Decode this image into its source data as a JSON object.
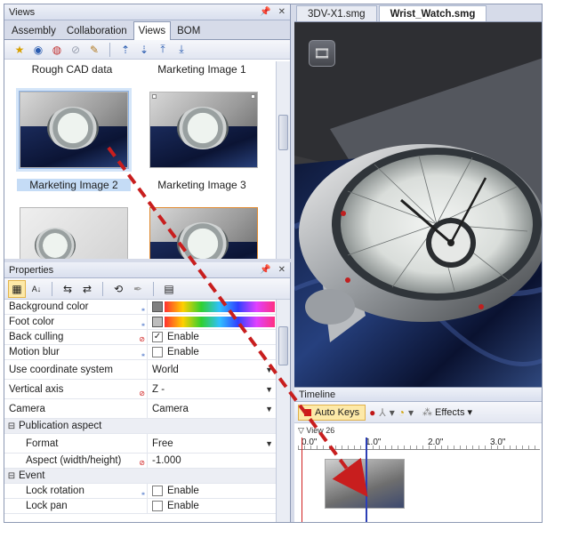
{
  "views_panel": {
    "title": "Views",
    "tabs": [
      "Assembly",
      "Collaboration",
      "Views",
      "BOM"
    ],
    "active_tab": "Views",
    "thumbnails": [
      {
        "label": "Rough CAD data"
      },
      {
        "label": "Marketing Image 1"
      },
      {
        "label": "Marketing Image 2",
        "selected": true
      },
      {
        "label": "Marketing Image 3"
      }
    ]
  },
  "properties_panel": {
    "title": "Properties",
    "rows": {
      "background_color": {
        "label": "Background color"
      },
      "foot_color": {
        "label": "Foot color"
      },
      "back_culling": {
        "label": "Back culling",
        "value": "Enable",
        "checked": true
      },
      "motion_blur": {
        "label": "Motion blur",
        "value": "Enable",
        "checked": false
      },
      "coordinate_system": {
        "label": "Use coordinate system",
        "value": "World"
      },
      "vertical_axis": {
        "label": "Vertical axis",
        "value": "Z -"
      },
      "camera": {
        "label": "Camera",
        "value": "Camera"
      },
      "publication_aspect": {
        "label": "Publication aspect",
        "expander": "⊟"
      },
      "format": {
        "label": "Format",
        "value": "Free"
      },
      "aspect": {
        "label": "Aspect (width/height)",
        "value": "-1.000"
      },
      "event": {
        "label": "Event",
        "expander": "⊟"
      },
      "lock_rotation": {
        "label": "Lock rotation",
        "value": "Enable"
      },
      "lock_pan": {
        "label": "Lock pan",
        "value": "Enable"
      }
    }
  },
  "document_tabs": [
    "3DV-X1.smg",
    "Wrist_Watch.smg"
  ],
  "active_document": "Wrist_Watch.smg",
  "timeline": {
    "title": "Timeline",
    "auto_keys_label": "Auto Keys",
    "effects_label": "Effects",
    "view_label": "View 26",
    "ticks": [
      "0.0\"",
      "1.0\"",
      "2.0\"",
      "3.0\""
    ]
  },
  "colors": {
    "panel_bg": "#d6dbe9",
    "selection": "#c5dcf6",
    "arrow": "#c81e1e",
    "playhead": "#2c3fb6"
  }
}
